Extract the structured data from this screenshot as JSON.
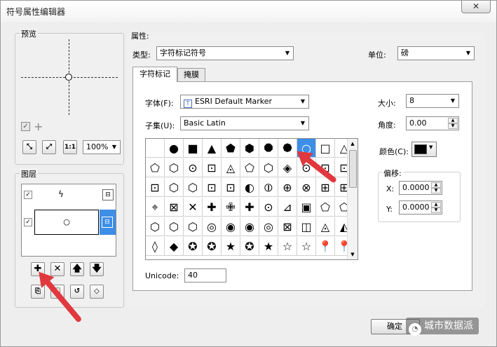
{
  "window": {
    "title": "符号属性编辑器",
    "close": "✕"
  },
  "preview": {
    "label": "预览",
    "zoom": "100%"
  },
  "layers": {
    "label": "图层",
    "row1_symbol": "ϟ",
    "row2_symbol": "○"
  },
  "properties": {
    "label": "属性:",
    "type_label": "类型:",
    "type_value": "字符标记符号",
    "unit_label": "单位:",
    "unit_value": "磅"
  },
  "tabs": [
    {
      "label": "字符标记"
    },
    {
      "label": "掩膜"
    }
  ],
  "font": {
    "label": "字体(F):",
    "value": "ESRI Default Marker"
  },
  "subset": {
    "label": "子集(U):",
    "value": "Basic Latin"
  },
  "size": {
    "label": "大小:",
    "value": "8"
  },
  "angle": {
    "label": "角度:",
    "value": "0.00"
  },
  "color": {
    "label": "颜色(C):",
    "swatch": "#000000"
  },
  "offset": {
    "label": "偏移:",
    "x_label": "X:",
    "x_value": "0.0000",
    "y_label": "Y:",
    "y_value": "0.0000"
  },
  "unicode": {
    "label": "Unicode:",
    "value": "40"
  },
  "glyphs": [
    "",
    "●",
    "■",
    "▲",
    "⬟",
    "⬢",
    "⯃",
    "⯄",
    "○",
    "□",
    "△",
    "⬠",
    "⬡",
    "⊙",
    "⊡",
    "◬",
    "⬠",
    "⬡",
    "◈",
    "⊙",
    "⊡",
    "⊡",
    "⊡",
    "⬡",
    "⬡",
    "⊡",
    "⊡",
    "◐",
    "⦶",
    "⊕",
    "⊗",
    "⊞",
    "⊞",
    "⌖",
    "⊠",
    "✕",
    "✚",
    "✙",
    "✚",
    "⊙",
    "⊿",
    "▣",
    "⬠",
    "⬠",
    "⬡",
    "⬡",
    "⬡",
    "◎",
    "◉",
    "◉",
    "◎",
    "⊠",
    "◫",
    "◬",
    "◭",
    "◊",
    "◆",
    "✪",
    "✪",
    "★",
    "✪",
    "★",
    "☆",
    "☆",
    "📍",
    "📍"
  ],
  "ok_button": "确定",
  "watermark": "城市数据派"
}
